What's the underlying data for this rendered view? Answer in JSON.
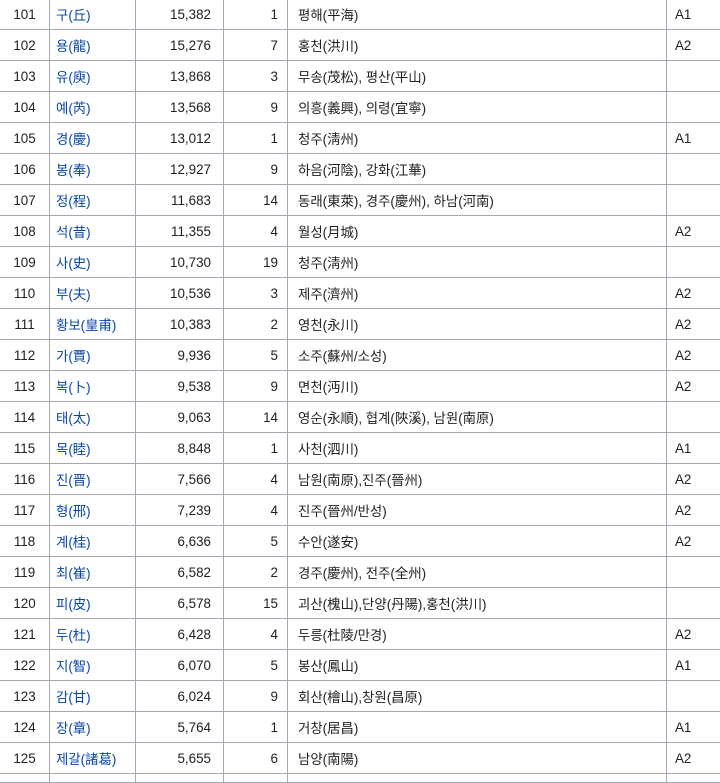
{
  "rows": [
    {
      "rank": "101",
      "name": "구(丘)",
      "population": "15,382",
      "clans": "1",
      "origin": "평해(平海)",
      "grade": "A1"
    },
    {
      "rank": "102",
      "name": "용(龍)",
      "population": "15,276",
      "clans": "7",
      "origin": "홍천(洪川)",
      "grade": "A2"
    },
    {
      "rank": "103",
      "name": "유(庾)",
      "population": "13,868",
      "clans": "3",
      "origin": "무송(茂松), 평산(平山)",
      "grade": ""
    },
    {
      "rank": "104",
      "name": "예(芮)",
      "population": "13,568",
      "clans": "9",
      "origin": "의흥(義興), 의령(宜寧)",
      "grade": ""
    },
    {
      "rank": "105",
      "name": "경(慶)",
      "population": "13,012",
      "clans": "1",
      "origin": "청주(淸州)",
      "grade": "A1"
    },
    {
      "rank": "106",
      "name": "봉(奉)",
      "population": "12,927",
      "clans": "9",
      "origin": "하음(河陰), 강화(江華)",
      "grade": ""
    },
    {
      "rank": "107",
      "name": "정(程)",
      "population": "11,683",
      "clans": "14",
      "origin": "동래(東萊), 경주(慶州), 하남(河南)",
      "grade": ""
    },
    {
      "rank": "108",
      "name": "석(昔)",
      "population": "11,355",
      "clans": "4",
      "origin": "월성(月城)",
      "grade": "A2"
    },
    {
      "rank": "109",
      "name": "사(史)",
      "population": "10,730",
      "clans": "19",
      "origin": "청주(淸州)",
      "grade": ""
    },
    {
      "rank": "110",
      "name": "부(夫)",
      "population": "10,536",
      "clans": "3",
      "origin": "제주(濟州)",
      "grade": "A2"
    },
    {
      "rank": "111",
      "name": "황보(皇甫)",
      "population": "10,383",
      "clans": "2",
      "origin": "영천(永川)",
      "grade": "A2"
    },
    {
      "rank": "112",
      "name": "가(賈)",
      "population": "9,936",
      "clans": "5",
      "origin": "소주(蘇州/소성)",
      "grade": "A2"
    },
    {
      "rank": "113",
      "name": "복(卜)",
      "population": "9,538",
      "clans": "9",
      "origin": "면천(沔川)",
      "grade": "A2"
    },
    {
      "rank": "114",
      "name": "태(太)",
      "population": "9,063",
      "clans": "14",
      "origin": "영순(永順), 협계(陜溪), 남원(南原)",
      "grade": ""
    },
    {
      "rank": "115",
      "name": "목(睦)",
      "population": "8,848",
      "clans": "1",
      "origin": "사천(泗川)",
      "grade": "A1"
    },
    {
      "rank": "116",
      "name": "진(晋)",
      "population": "7,566",
      "clans": "4",
      "origin": "남원(南原),진주(晉州)",
      "grade": "A2"
    },
    {
      "rank": "117",
      "name": "형(邢)",
      "population": "7,239",
      "clans": "4",
      "origin": "진주(晉州/반성)",
      "grade": "A2"
    },
    {
      "rank": "118",
      "name": "계(桂)",
      "population": "6,636",
      "clans": "5",
      "origin": "수안(遂安)",
      "grade": "A2"
    },
    {
      "rank": "119",
      "name": "최(崔)",
      "population": "6,582",
      "clans": "2",
      "origin": "경주(慶州), 전주(全州)",
      "grade": ""
    },
    {
      "rank": "120",
      "name": "피(皮)",
      "population": "6,578",
      "clans": "15",
      "origin": "괴산(槐山),단양(丹陽),홍천(洪川)",
      "grade": ""
    },
    {
      "rank": "121",
      "name": "두(杜)",
      "population": "6,428",
      "clans": "4",
      "origin": "두릉(杜陵/만경)",
      "grade": "A2"
    },
    {
      "rank": "122",
      "name": "지(智)",
      "population": "6,070",
      "clans": "5",
      "origin": "봉산(鳳山)",
      "grade": "A1"
    },
    {
      "rank": "123",
      "name": "감(甘)",
      "population": "6,024",
      "clans": "9",
      "origin": "회산(檜山),창원(昌原)",
      "grade": ""
    },
    {
      "rank": "124",
      "name": "장(章)",
      "population": "5,764",
      "clans": "1",
      "origin": "거창(居昌)",
      "grade": "A1"
    },
    {
      "rank": "125",
      "name": "제갈(諸葛)",
      "population": "5,655",
      "clans": "6",
      "origin": "남양(南陽)",
      "grade": "A2"
    }
  ]
}
